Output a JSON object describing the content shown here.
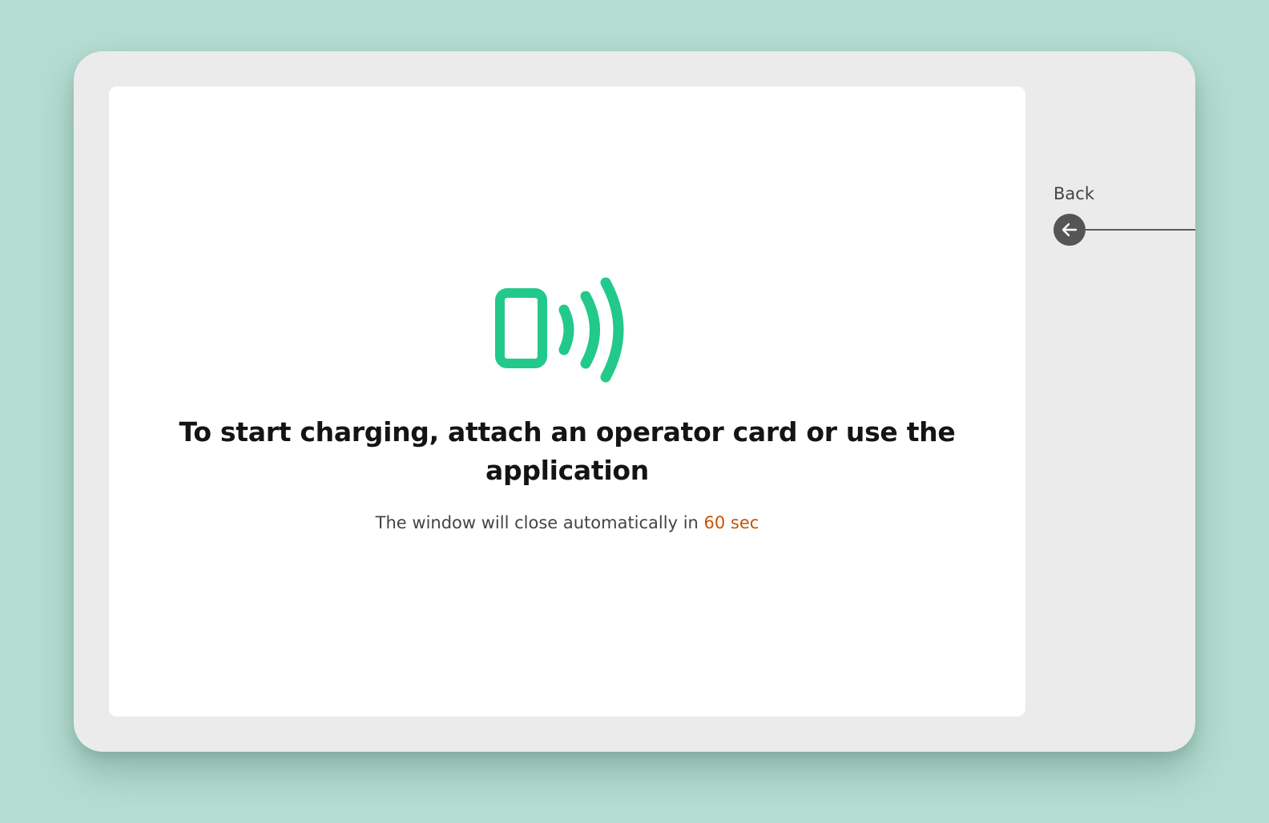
{
  "screen": {
    "message": "To start charging, attach an operator card or use the application",
    "countdown": {
      "prefix": "The window will close automatically in ",
      "value": "60 sec"
    },
    "icon": "nfc-phone-icon"
  },
  "back": {
    "label": "Back",
    "icon": "arrow-left-icon"
  },
  "colors": {
    "background": "#b6ddd2",
    "device": "#ebebeb",
    "accent": "#22c98b",
    "countdown": "#c65308",
    "back_button": "#555555"
  }
}
